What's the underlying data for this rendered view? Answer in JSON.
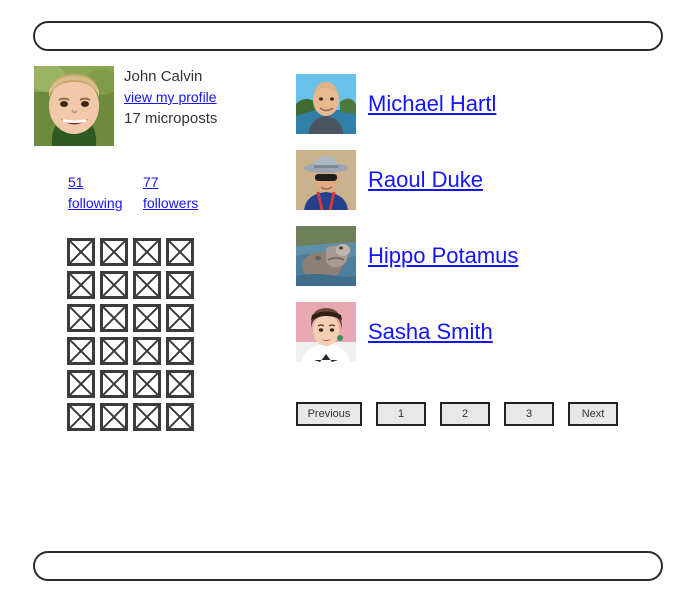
{
  "header": {
    "bar_label": ""
  },
  "footer": {
    "bar_label": ""
  },
  "sidebar": {
    "profile": {
      "avatar_icon": "gravatar-boy-image",
      "name": "John Calvin",
      "profile_link": "view my profile",
      "microposts": "17 microposts"
    },
    "stats": [
      {
        "count": "51",
        "label": "following"
      },
      {
        "count": "77",
        "label": "followers"
      }
    ],
    "micropost_grid": {
      "placeholder_icon": "broken-image-icon",
      "rows": 6,
      "columns": 4
    }
  },
  "users": [
    {
      "name": "Michael Hartl",
      "avatar_icon": "user-avatar-image"
    },
    {
      "name": "Raoul Duke",
      "avatar_icon": "user-avatar-image"
    },
    {
      "name": "Hippo Potamus",
      "avatar_icon": "user-avatar-image"
    },
    {
      "name": "Sasha Smith",
      "avatar_icon": "user-avatar-image"
    }
  ],
  "pagination": {
    "previous": "Previous",
    "pages": [
      "1",
      "2",
      "3"
    ],
    "next": "Next"
  },
  "colors": {
    "link": "#1414ff",
    "text": "#333333",
    "border": "#2b2b2b",
    "button_fill": "#e8e8e8"
  }
}
